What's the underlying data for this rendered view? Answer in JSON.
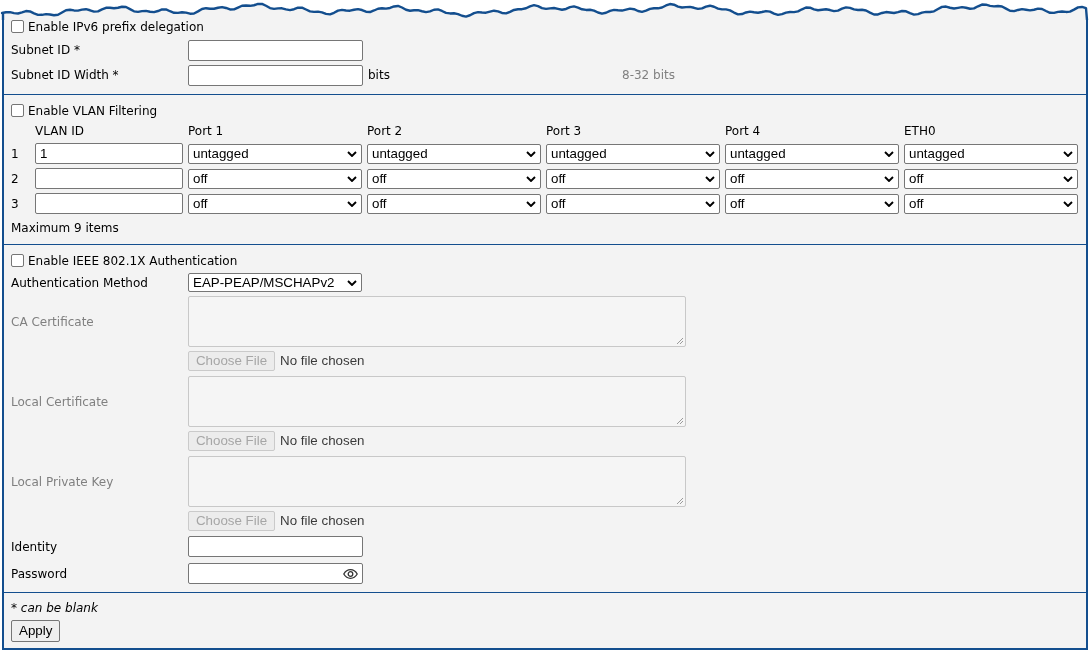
{
  "ipv6": {
    "enable": {
      "label": "Enable IPv6 prefix delegation",
      "checked": false
    },
    "fields": [
      {
        "label": "Subnet ID *"
      },
      {
        "label": "Subnet ID Width *",
        "unit": "bits",
        "hint": "8-32 bits"
      }
    ]
  },
  "vlan": {
    "enable": {
      "label": "Enable VLAN Filtering",
      "checked": false
    },
    "columns": [
      "VLAN ID",
      "Port 1",
      "Port 2",
      "Port 3",
      "Port 4",
      "ETH0"
    ],
    "rows": [
      {
        "number": "1",
        "vlan_id": "1",
        "ports": [
          "untagged",
          "untagged",
          "untagged",
          "untagged",
          "untagged"
        ]
      },
      {
        "number": "2",
        "ports": [
          "off",
          "off",
          "off",
          "off",
          "off"
        ]
      },
      {
        "number": "3",
        "ports": [
          "off",
          "off",
          "off",
          "off",
          "off"
        ]
      }
    ],
    "note": "Maximum 9 items"
  },
  "auth": {
    "enable": {
      "label": "Enable IEEE 802.1X Authentication",
      "checked": false
    },
    "method": {
      "label": "Authentication Method",
      "value": "EAP-PEAP/MSCHAPv2"
    },
    "certificates": [
      {
        "label": "CA Certificate",
        "disabled": true,
        "button": "Choose File",
        "status": "No file chosen"
      },
      {
        "label": "Local Certificate",
        "disabled": true,
        "button": "Choose File",
        "status": "No file chosen"
      },
      {
        "label": "Local Private Key",
        "disabled": true,
        "button": "Choose File",
        "status": "No file chosen"
      }
    ],
    "credentials": [
      {
        "label": "Identity",
        "kind": "text"
      },
      {
        "label": "Password",
        "kind": "password"
      }
    ]
  },
  "footer": {
    "note": "* *can be blank*",
    "button": "Apply"
  }
}
